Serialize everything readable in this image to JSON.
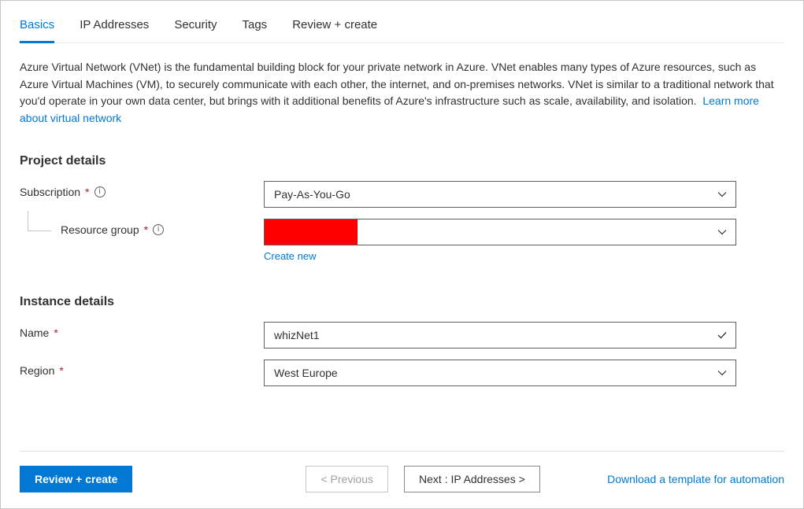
{
  "tabs": {
    "basics": "Basics",
    "ip": "IP Addresses",
    "security": "Security",
    "tags": "Tags",
    "review": "Review + create"
  },
  "description": {
    "text": "Azure Virtual Network (VNet) is the fundamental building block for your private network in Azure. VNet enables many types of Azure resources, such as Azure Virtual Machines (VM), to securely communicate with each other, the internet, and on-premises networks. VNet is similar to a traditional network that you'd operate in your own data center, but brings with it additional benefits of Azure's infrastructure such as scale, availability, and isolation.",
    "learn_more": "Learn more about virtual network"
  },
  "sections": {
    "project": "Project details",
    "instance": "Instance details"
  },
  "labels": {
    "subscription": "Subscription",
    "resource_group": "Resource group",
    "create_new": "Create new",
    "name": "Name",
    "region": "Region"
  },
  "values": {
    "subscription": "Pay-As-You-Go",
    "resource_group": "",
    "name": "whizNet1",
    "region": "West Europe"
  },
  "footer": {
    "review": "Review + create",
    "previous": "< Previous",
    "next": "Next : IP Addresses >",
    "download_template": "Download a template for automation"
  }
}
